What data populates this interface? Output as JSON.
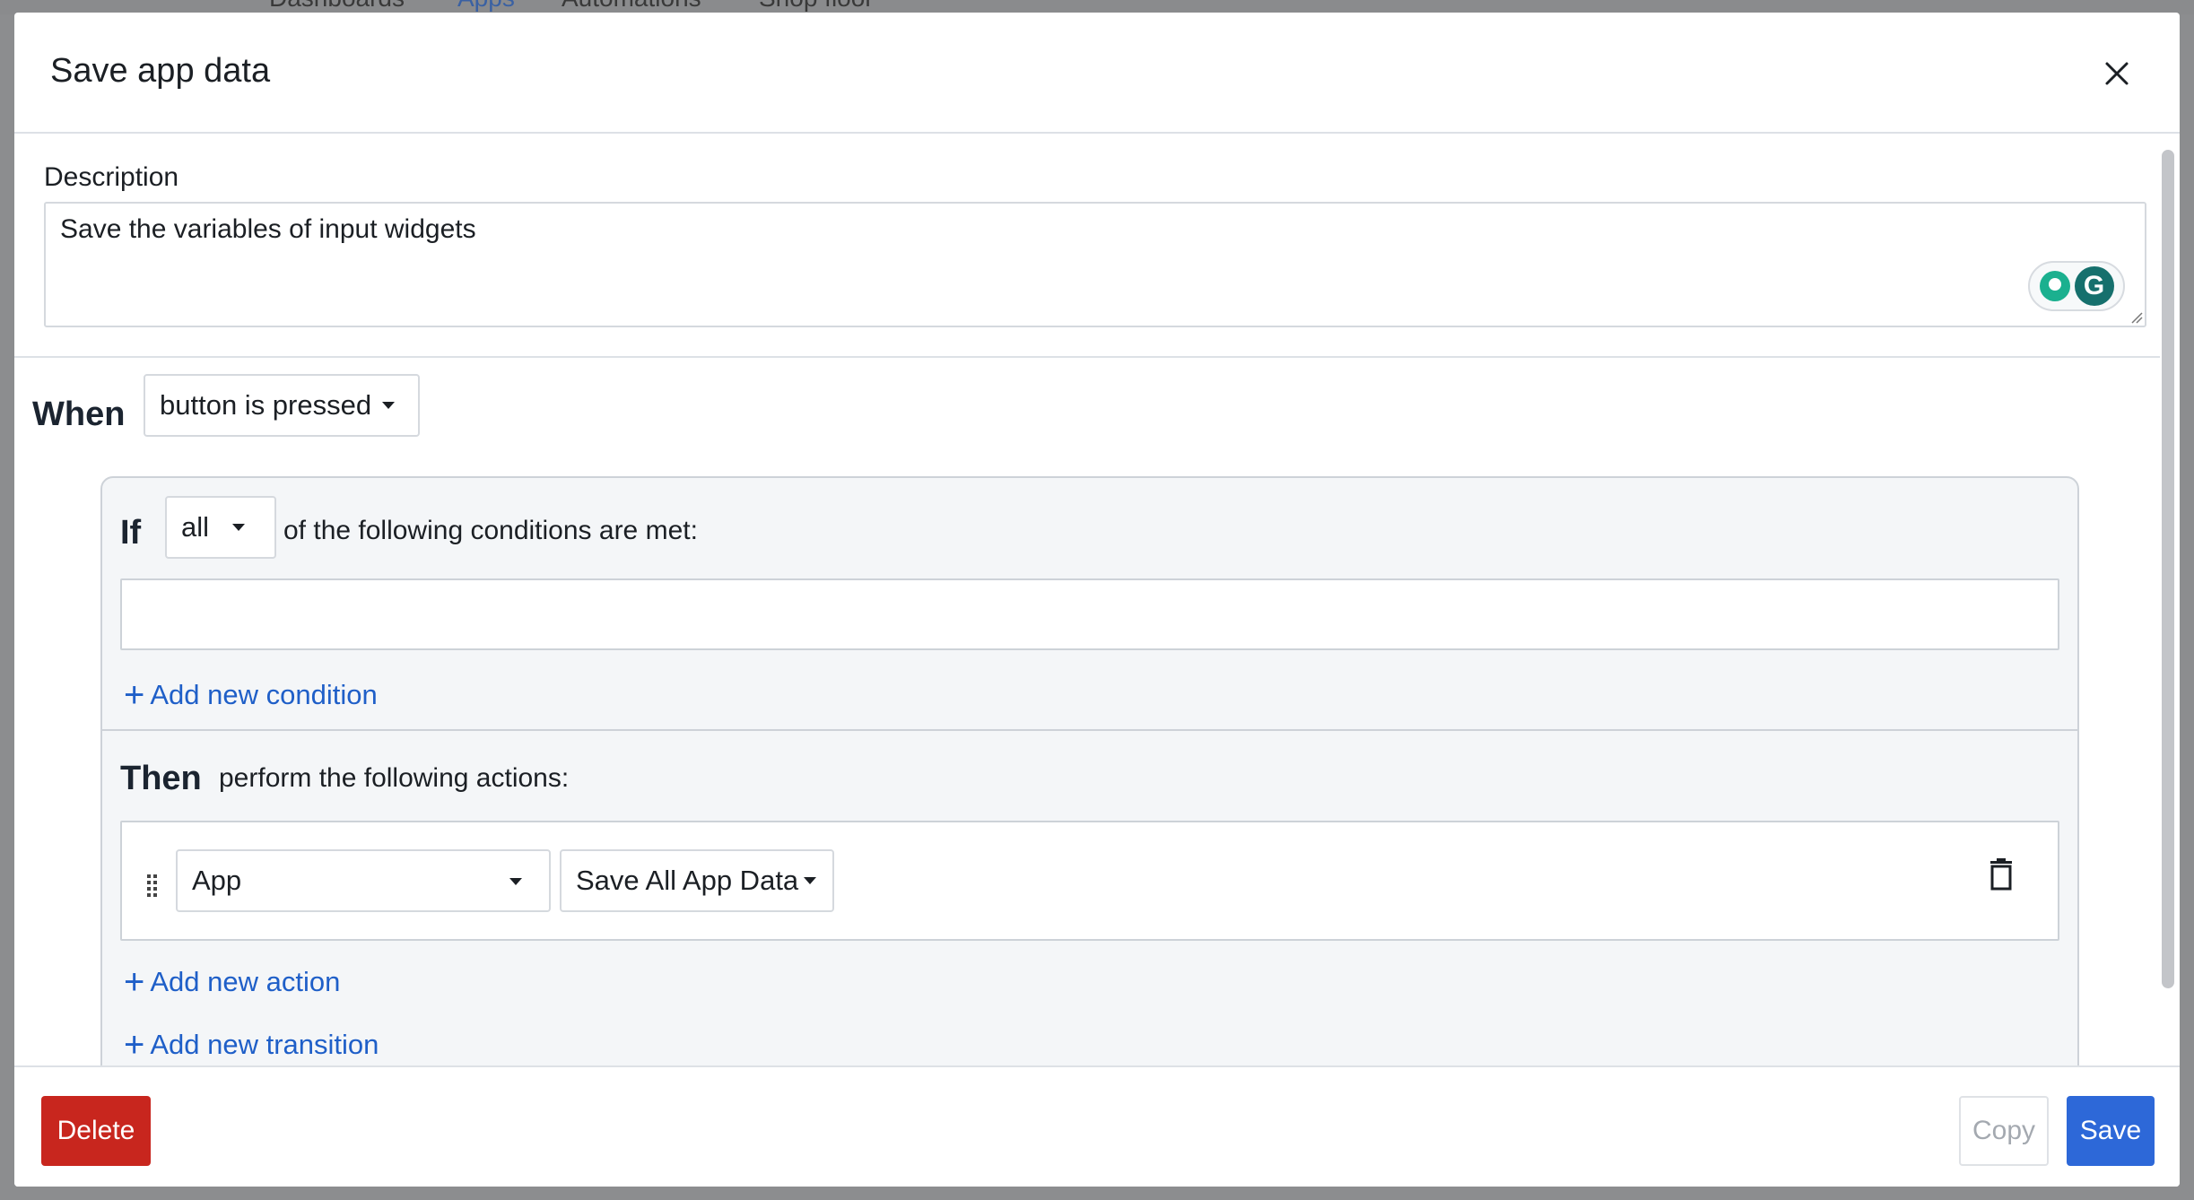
{
  "background": {
    "nav_items": [
      "Dashboards",
      "Apps",
      "Automations",
      "Shop floor"
    ]
  },
  "modal": {
    "title": "Save app data",
    "description": {
      "label": "Description",
      "value": "Save the variables of input widgets"
    },
    "when": {
      "label": "When",
      "trigger": "button is pressed"
    },
    "if": {
      "label": "If",
      "quantifier": "all",
      "text": "of the following conditions are met:",
      "add_condition": "Add new condition"
    },
    "then": {
      "label": "Then",
      "text": "perform the following actions:",
      "action": {
        "target": "App",
        "operation": "Save All App Data"
      },
      "add_action": "Add new action",
      "add_transition": "Add new transition"
    },
    "footer": {
      "delete": "Delete",
      "copy": "Copy",
      "save": "Save"
    }
  },
  "colors": {
    "primary": "#2d68d8",
    "danger": "#c8261e",
    "link": "#1f5fc8",
    "grammarly": "#16706d"
  },
  "icons": [
    "close-icon",
    "grammarly-icon",
    "drag-handle-icon",
    "trash-icon",
    "chevron-down-icon",
    "plus-icon"
  ]
}
